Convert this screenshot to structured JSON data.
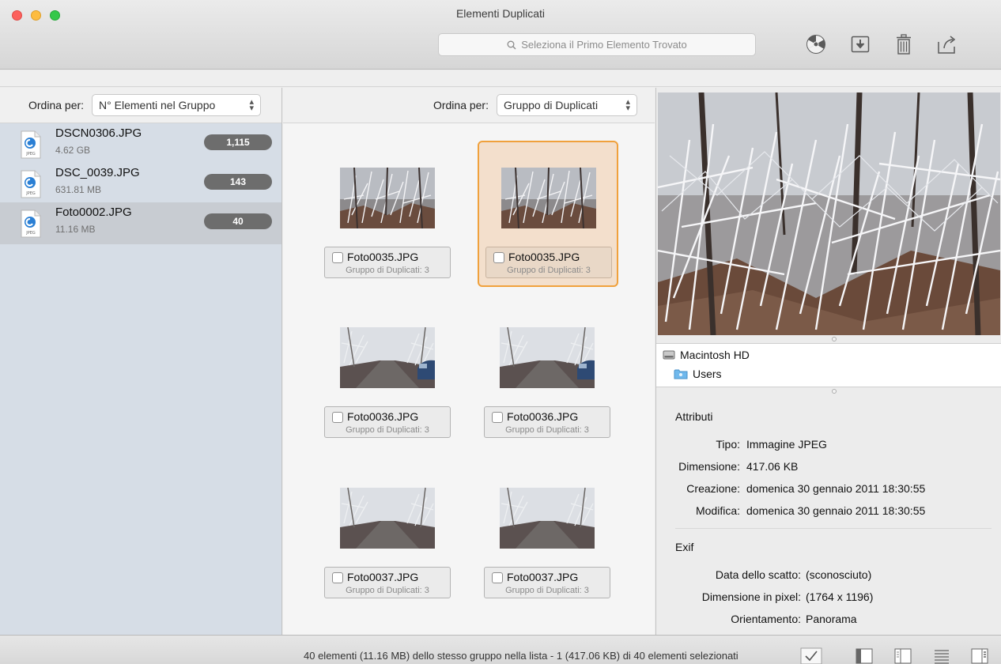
{
  "window": {
    "title": "Elementi Duplicati",
    "search_placeholder": "Seleziona il Primo Elemento Trovato"
  },
  "toolbar": {
    "icons": [
      "radiation-icon",
      "download-icon",
      "trash-icon",
      "share-icon"
    ]
  },
  "left": {
    "sort_label": "Ordina per:",
    "sort_value": "N° Elementi nel Gruppo",
    "groups": [
      {
        "name": "DSCN0306.JPG",
        "size": "4.62 GB",
        "count": "1,115",
        "selected": false
      },
      {
        "name": "DSC_0039.JPG",
        "size": "631.81 MB",
        "count": "143",
        "selected": false
      },
      {
        "name": "Foto0002.JPG",
        "size": "11.16 MB",
        "count": "40",
        "selected": true
      }
    ],
    "file_icon_label": "JPEG"
  },
  "middle": {
    "sort_label": "Ordina per:",
    "sort_value": "Gruppo di Duplicati",
    "items": [
      {
        "name": "Foto0035.JPG",
        "group": "Gruppo di Duplicati: 3",
        "selected": false,
        "scene": "forest"
      },
      {
        "name": "Foto0035.JPG",
        "group": "Gruppo di Duplicati: 3",
        "selected": true,
        "scene": "forest"
      },
      {
        "name": "Foto0036.JPG",
        "group": "Gruppo di Duplicati: 3",
        "selected": false,
        "scene": "road-car"
      },
      {
        "name": "Foto0036.JPG",
        "group": "Gruppo di Duplicati: 3",
        "selected": false,
        "scene": "road-car"
      },
      {
        "name": "Foto0037.JPG",
        "group": "Gruppo di Duplicati: 3",
        "selected": false,
        "scene": "road"
      },
      {
        "name": "Foto0037.JPG",
        "group": "Gruppo di Duplicati: 3",
        "selected": false,
        "scene": "road"
      }
    ]
  },
  "right": {
    "path": [
      "Macintosh HD",
      "Users"
    ],
    "attributes_title": "Attributi",
    "attributes": {
      "type_label": "Tipo:",
      "type_value": "Immagine JPEG",
      "size_label": "Dimensione:",
      "size_value": "417.06 KB",
      "created_label": "Creazione:",
      "created_value": "domenica 30 gennaio 2011 18:30:55",
      "modified_label": "Modifica:",
      "modified_value": "domenica 30 gennaio 2011 18:30:55"
    },
    "exif_title": "Exif",
    "exif": {
      "date_label": "Data dello scatto:",
      "date_value": "(sconosciuto)",
      "pixels_label": "Dimensione in pixel:",
      "pixels_value": "(1764 x 1196)",
      "orientation_label": "Orientamento:",
      "orientation_value": "Panorama"
    }
  },
  "status": {
    "text": "40 elementi (11.16 MB) dello stesso gruppo nella lista - 1 (417.06 KB) di 40 elementi selezionati"
  }
}
